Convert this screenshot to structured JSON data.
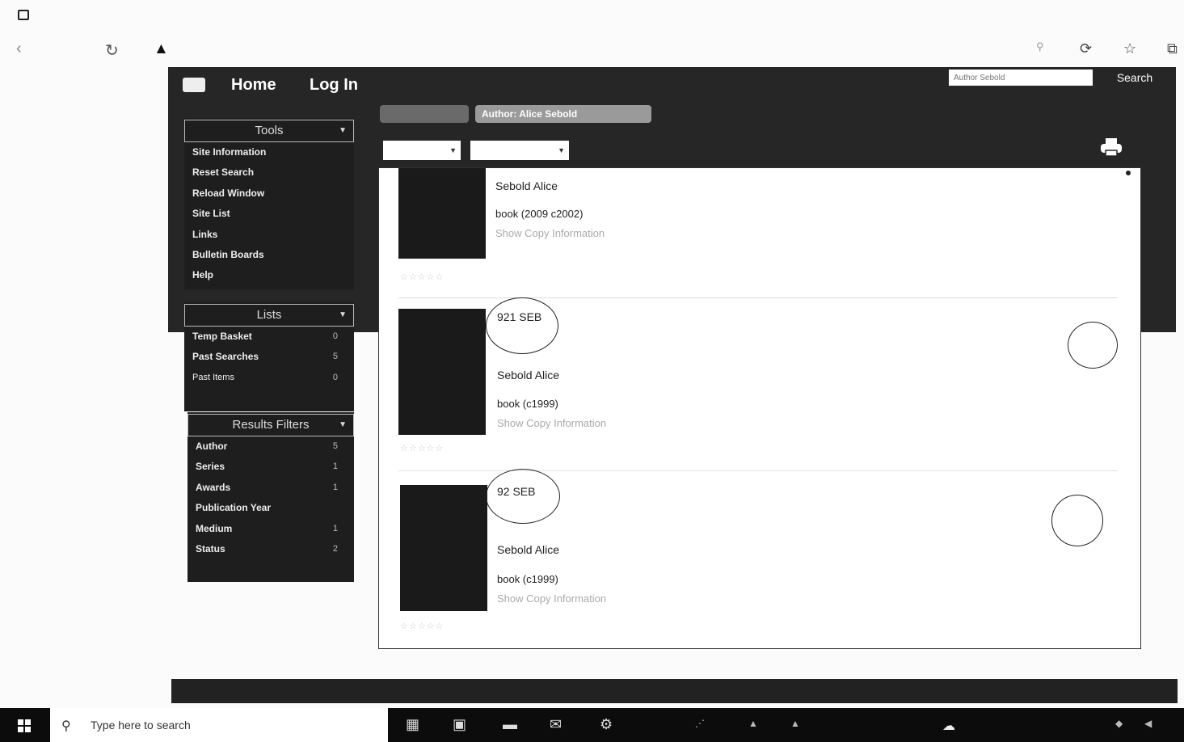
{
  "navbar": {
    "home": "Home",
    "login": "Log In",
    "search_placeholder": "Author Sebold",
    "search_label": "Search"
  },
  "chips": {
    "second": "Author: Alice Sebold"
  },
  "tools": {
    "title": "Tools",
    "items": [
      "Site Information",
      "Reset Search",
      "Reload Window",
      "Site List",
      "Links",
      "Bulletin Boards",
      "Help"
    ]
  },
  "lists": {
    "title": "Lists",
    "items": [
      {
        "label": "Temp Basket",
        "count": "0"
      },
      {
        "label": "Past Searches",
        "count": "5"
      },
      {
        "label": "Past Items",
        "count": "0"
      }
    ]
  },
  "filters": {
    "title": "Results Filters",
    "items": [
      {
        "label": "Author",
        "count": "5"
      },
      {
        "label": "Series",
        "count": "1"
      },
      {
        "label": "Awards",
        "count": "1"
      },
      {
        "label": "Publication Year",
        "count": ""
      },
      {
        "label": "Medium",
        "count": "1"
      },
      {
        "label": "Status",
        "count": "2"
      }
    ]
  },
  "results": [
    {
      "call_number": "",
      "call_sub": "",
      "author": "Sebold Alice",
      "edition": "book (2009 c2002)",
      "copy": "Show Copy Information",
      "thumb": "",
      "detail": "",
      "corner": ""
    },
    {
      "call_number": "921 SEB",
      "call_sub": "",
      "author": "Sebold Alice",
      "edition": "book (c1999)",
      "copy": "Show Copy Information",
      "thumb": "",
      "detail": "",
      "corner": ""
    },
    {
      "call_number": "92 SEB",
      "call_sub": "",
      "author": "Sebold Alice",
      "edition": "book (c1999)",
      "copy": "Show Copy Information",
      "thumb": "",
      "detail": "",
      "corner": ""
    }
  ],
  "footer": {
    "left": "",
    "right": ""
  },
  "taskbar": {
    "search_placeholder": "Type here to search"
  }
}
